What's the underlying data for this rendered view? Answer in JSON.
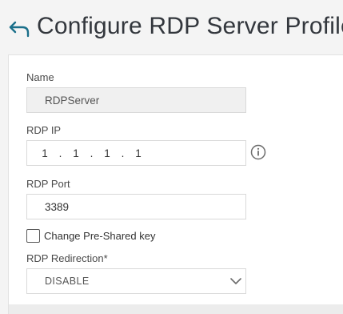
{
  "header": {
    "title": "Configure RDP Server Profile"
  },
  "form": {
    "name": {
      "label": "Name",
      "value": "RDPServer"
    },
    "rdp_ip": {
      "label": "RDP IP",
      "octets": [
        "1",
        "1",
        "1",
        "1"
      ],
      "separator": "."
    },
    "rdp_port": {
      "label": "RDP Port",
      "value": "3389"
    },
    "change_psk": {
      "label": "Change Pre-Shared key",
      "checked": false
    },
    "rdp_redirection": {
      "label": "RDP Redirection*",
      "selected": "DISABLE"
    }
  },
  "colors": {
    "accent": "#1a6f8a",
    "background": "#f4f4f4",
    "panel": "#ffffff",
    "disabled_field": "#f0f0f0"
  },
  "icons": {
    "back": "back-arrow-icon",
    "info": "info-icon",
    "dropdown": "chevron-down-icon"
  }
}
